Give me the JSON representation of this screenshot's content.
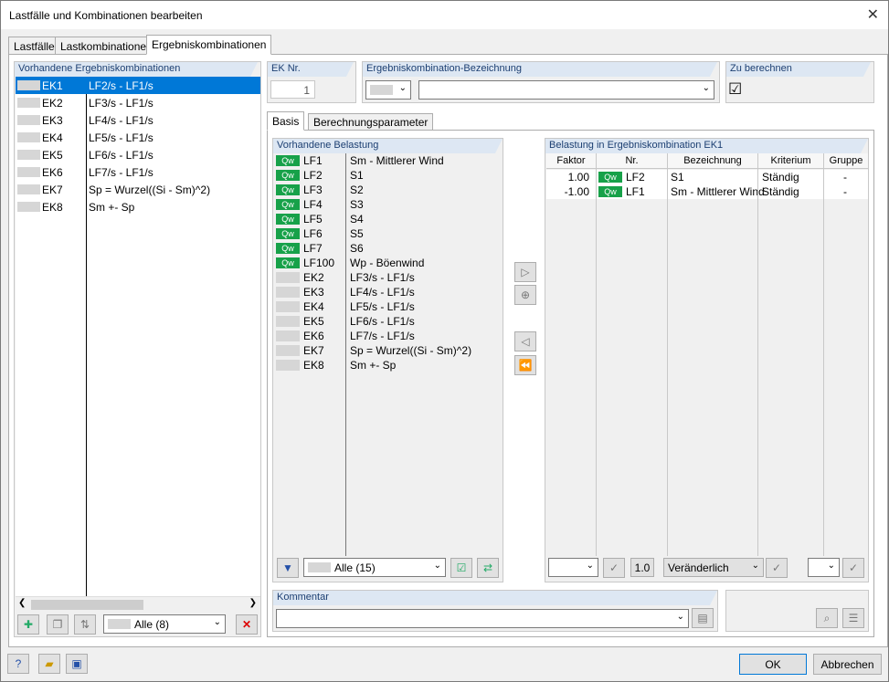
{
  "window": {
    "title": "Lastfälle und Kombinationen bearbeiten",
    "close": "✕"
  },
  "tabs": [
    "Lastfälle",
    "Lastkombinationen",
    "Ergebniskombinationen"
  ],
  "left": {
    "header": "Vorhandene Ergebniskombinationen",
    "items": [
      {
        "id": "EK1",
        "desc": "LF2/s - LF1/s"
      },
      {
        "id": "EK2",
        "desc": "LF3/s - LF1/s"
      },
      {
        "id": "EK3",
        "desc": "LF4/s - LF1/s"
      },
      {
        "id": "EK4",
        "desc": "LF5/s - LF1/s"
      },
      {
        "id": "EK5",
        "desc": "LF6/s - LF1/s"
      },
      {
        "id": "EK6",
        "desc": "LF7/s - LF1/s"
      },
      {
        "id": "EK7",
        "desc": "Sp = Wurzel((Si - Sm)^2)"
      },
      {
        "id": "EK8",
        "desc": "Sm +- Sp"
      }
    ],
    "filter": "Alle (8)"
  },
  "ek_nr": {
    "label": "EK Nr.",
    "value": "1"
  },
  "bezeichnung": {
    "label": "Ergebniskombination-Bezeichnung",
    "value": ""
  },
  "zu_berechnen": {
    "label": "Zu berechnen",
    "checked": "☑"
  },
  "inner_tabs": [
    "Basis",
    "Berechnungsparameter"
  ],
  "vorhandene": {
    "header": "Vorhandene Belastung",
    "qw": "Qw",
    "items": [
      {
        "qw": true,
        "id": "LF1",
        "desc": "Sm - Mittlerer Wind"
      },
      {
        "qw": true,
        "id": "LF2",
        "desc": "S1"
      },
      {
        "qw": true,
        "id": "LF3",
        "desc": "S2"
      },
      {
        "qw": true,
        "id": "LF4",
        "desc": "S3"
      },
      {
        "qw": true,
        "id": "LF5",
        "desc": "S4"
      },
      {
        "qw": true,
        "id": "LF6",
        "desc": "S5"
      },
      {
        "qw": true,
        "id": "LF7",
        "desc": "S6"
      },
      {
        "qw": true,
        "id": "LF100",
        "desc": "Wp - Böenwind"
      },
      {
        "qw": false,
        "id": "EK2",
        "desc": "LF3/s - LF1/s"
      },
      {
        "qw": false,
        "id": "EK3",
        "desc": "LF4/s - LF1/s"
      },
      {
        "qw": false,
        "id": "EK4",
        "desc": "LF5/s - LF1/s"
      },
      {
        "qw": false,
        "id": "EK5",
        "desc": "LF6/s - LF1/s"
      },
      {
        "qw": false,
        "id": "EK6",
        "desc": "LF7/s - LF1/s"
      },
      {
        "qw": false,
        "id": "EK7",
        "desc": "Sp = Wurzel((Si - Sm)^2)"
      },
      {
        "qw": false,
        "id": "EK8",
        "desc": "Sm +- Sp"
      }
    ],
    "filter": "Alle (15)"
  },
  "belastung": {
    "header": "Belastung in Ergebniskombination EK1",
    "columns": [
      "Faktor",
      "Nr.",
      "Bezeichnung",
      "Kriterium",
      "Gruppe"
    ],
    "rows": [
      {
        "faktor": "1.00",
        "nr": "LF2",
        "bez": "S1",
        "krit": "Ständig",
        "gruppe": "-"
      },
      {
        "faktor": "-1.00",
        "nr": "LF1",
        "bez": "Sm - Mittlerer Wind",
        "krit": "Ständig",
        "gruppe": "-"
      }
    ],
    "factor_btn": "1.0",
    "kriterium": "Veränderlich"
  },
  "kommentar": {
    "label": "Kommentar",
    "value": ""
  },
  "buttons": {
    "ok": "OK",
    "cancel": "Abbrechen"
  }
}
